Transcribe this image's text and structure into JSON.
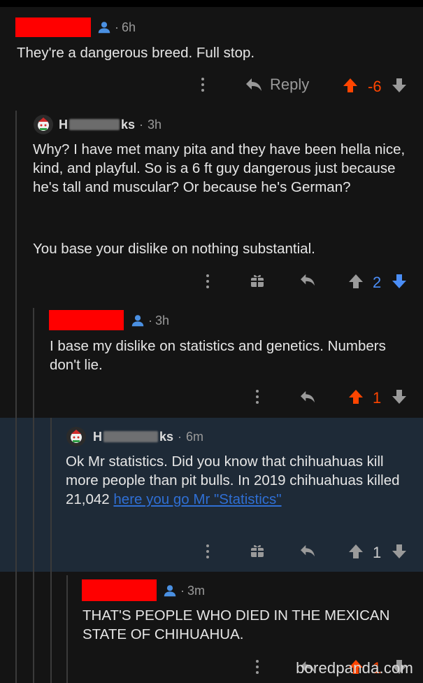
{
  "comments": [
    {
      "time": "6h",
      "text": "They're a dangerous breed. Full stop.",
      "reply_label": "Reply",
      "score": "-6"
    },
    {
      "username_start": "H",
      "username_end": "ks",
      "time": "3h",
      "text_p1": "Why? I have met many pita and they have been hella nice, kind, and playful. So is a 6 ft guy dangerous just because he's tall and muscular? Or because he's German?",
      "text_p2": "You base your dislike on nothing substantial.",
      "score": "2"
    },
    {
      "time": "3h",
      "text": "I base my dislike on statistics and genetics. Numbers don't lie.",
      "score": "1"
    },
    {
      "username_start": "H",
      "username_end": "ks",
      "time": "6m",
      "text": "Ok Mr statistics. Did you know that chihuahuas kill more people than pit bulls. In 2019 chihuahuas killed 21,042",
      "link_text": "here you go Mr \"Statistics\"",
      "score": "1"
    },
    {
      "time": "3m",
      "text": "THAT'S PEOPLE WHO DIED IN THE MEXICAN STATE OF CHIHUAHUA.",
      "score": "1"
    }
  ],
  "watermark": "boredpanda.com",
  "colors": {
    "upvote": "#ff4500",
    "downvote": "#4b8ef7",
    "redaction": "#ff0000"
  }
}
